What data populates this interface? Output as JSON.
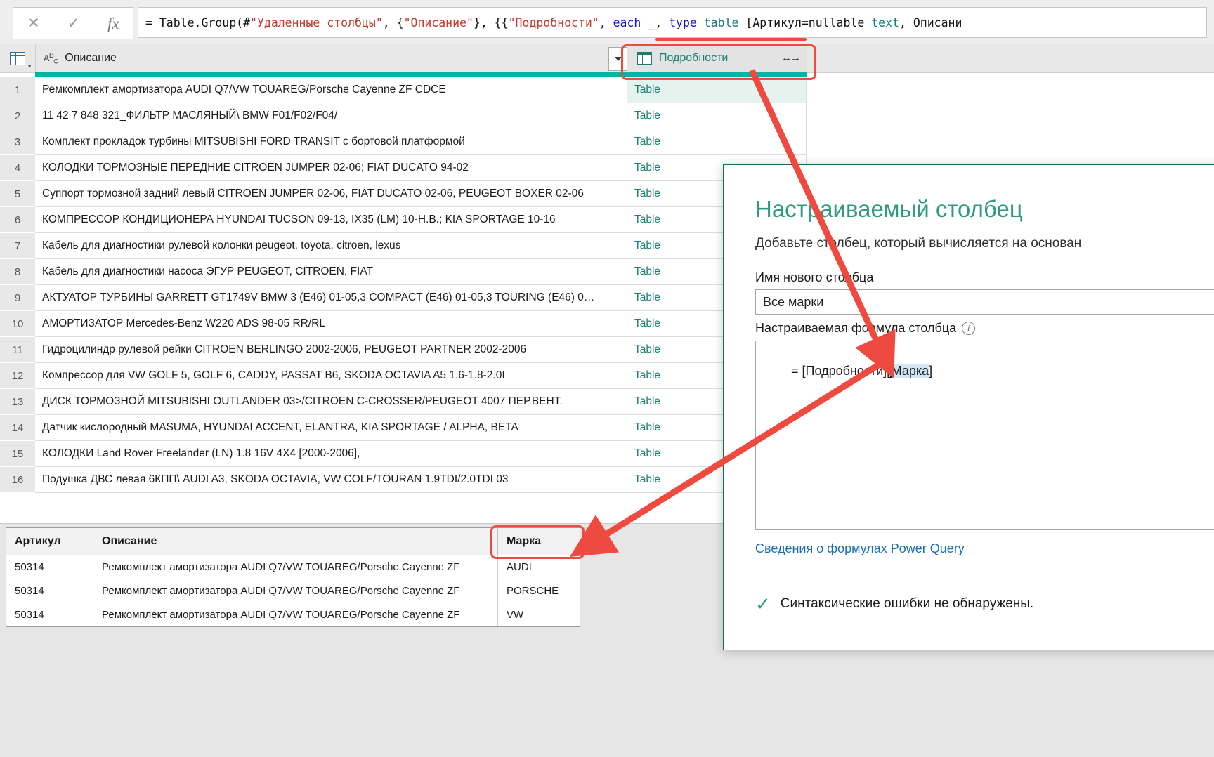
{
  "formula_bar": {
    "cancel_icon": "close-icon",
    "accept_icon": "check-icon",
    "fx_icon": "fx-icon",
    "segments": [
      {
        "t": "= Table.Group(#",
        "k": "plain"
      },
      {
        "t": "\"Удаленные столбцы\"",
        "k": "string"
      },
      {
        "t": ", {",
        "k": "plain"
      },
      {
        "t": "\"Описание\"",
        "k": "string"
      },
      {
        "t": "}, {{",
        "k": "plain"
      },
      {
        "t": "\"Подробности\"",
        "k": "string"
      },
      {
        "t": ", ",
        "k": "plain"
      },
      {
        "t": "each",
        "k": "keyword"
      },
      {
        "t": " _, ",
        "k": "plain"
      },
      {
        "t": "type",
        "k": "keyword"
      },
      {
        "t": " ",
        "k": "plain"
      },
      {
        "t": "table",
        "k": "type"
      },
      {
        "t": " [Артикул=nullable ",
        "k": "plain"
      },
      {
        "t": "text",
        "k": "type"
      },
      {
        "t": ", Описани",
        "k": "plain"
      }
    ],
    "full_text": "= Table.Group(#\"Удаленные столбцы\", {\"Описание\"}, {{\"Подробности\", each _, type table [Артикул=nullable text, Описани"
  },
  "grid": {
    "columns": [
      {
        "label": "Описание",
        "type_icon": "abc-icon",
        "filter_icon": "filter-caret-icon"
      },
      {
        "label": "Подробности",
        "type_icon": "table-icon",
        "expand_icon": "expand-columns-icon"
      }
    ],
    "corner_icon": "select-all-grid-icon",
    "rows": [
      {
        "n": "1",
        "desc": "Ремкомплект амортизатора AUDI Q7/VW TOUAREG/Porsche Cayenne ZF CDCE",
        "detail": "Table"
      },
      {
        "n": "2",
        "desc": " 11 42 7 848 321_ФИЛЬТР МАСЛЯНЫЙ\\ BMW F01/F02/F04/",
        "detail": "Table"
      },
      {
        "n": "3",
        "desc": "Комплект прокладок турбины MITSUBISHI  FORD TRANSIT с бортовой платформой",
        "detail": "Table"
      },
      {
        "n": "4",
        "desc": "КОЛОДКИ ТОРМОЗНЫЕ ПЕРЕДНИЕ CITROEN JUMPER 02-06; FIAT DUCATO 94-02",
        "detail": "Table"
      },
      {
        "n": "5",
        "desc": "Суппорт тормозной задний левый CITROEN JUMPER 02-06, FIAT DUCATO 02-06, PEUGEOT BOXER 02-06",
        "detail": "Table"
      },
      {
        "n": "6",
        "desc": "КОМПРЕССОР КОНДИЦИОНЕРА HYUNDAI TUCSON 09-13, IX35 (LM) 10-H.B.; KIA SPORTAGE 10-16",
        "detail": "Table"
      },
      {
        "n": "7",
        "desc": "Кабель для диагностики рулевой колонки peugeot, toyota, citroen, lexus",
        "detail": "Table"
      },
      {
        "n": "8",
        "desc": "Кабель для диагностики насоса ЭГУР PEUGEOT, CITROEN, FIAT",
        "detail": "Table"
      },
      {
        "n": "9",
        "desc": "АКТУАТОР ТУРБИНЫ GARRETT GT1749V BMW 3 (E46) 01-05,3 COMPACT (E46) 01-05,3 TOURING (E46) 0…",
        "detail": "Table"
      },
      {
        "n": "10",
        "desc": "АМОРТИЗАТОР Mercedes-Benz W220 ADS 98-05 RR/RL",
        "detail": "Table"
      },
      {
        "n": "11",
        "desc": "Гидроцилиндр рулевой рейки CITROEN BERLINGO 2002-2006, PEUGEOT PARTNER 2002-2006",
        "detail": "Table"
      },
      {
        "n": "12",
        "desc": "Компрессор для VW GOLF 5, GOLF 6, CADDY, PASSAT B6, SKODA OCTAVIA A5 1.6-1.8-2.0I",
        "detail": "Table"
      },
      {
        "n": "13",
        "desc": "ДИСК ТОРМОЗНОЙ MITSUBISHI OUTLANDER 03>/CITROEN C-CROSSER/PEUGEOT 4007 ПЕР.ВЕНТ.",
        "detail": "Table"
      },
      {
        "n": "14",
        "desc": "Датчик кислородный MASUMA, HYUNDAI ACCENT, ELANTRA, KIA SPORTAGE / ALPHA, BETA",
        "detail": "Table"
      },
      {
        "n": "15",
        "desc": "КОЛОДКИ Land Rover Freelander (LN) 1.8 16V 4X4 [2000-2006],",
        "detail": "Table"
      },
      {
        "n": "16",
        "desc": "Подушка ДВС левая 6КПП\\ AUDI A3, SKODA OCTAVIA, VW COLF/TOURAN 1.9TDI/2.0TDI 03",
        "detail": "Table"
      }
    ]
  },
  "preview": {
    "headers": [
      "Артикул",
      "Описание",
      "Марка"
    ],
    "rows": [
      [
        "50314",
        "Ремкомплект амортизатора AUDI Q7/VW TOUAREG/Porsche Cayenne ZF",
        "AUDI"
      ],
      [
        "50314",
        "Ремкомплект амортизатора AUDI Q7/VW TOUAREG/Porsche Cayenne ZF",
        "PORSCHE"
      ],
      [
        "50314",
        "Ремкомплект амортизатора AUDI Q7/VW TOUAREG/Porsche Cayenne ZF",
        "VW"
      ]
    ]
  },
  "dialog": {
    "title": "Настраиваемый столбец",
    "subtitle": "Добавьте столбец, который вычисляется на основан",
    "name_label": "Имя нового столбца",
    "name_value": "Все марки",
    "formula_label": "Настраиваемая формула столбца",
    "info_icon": "info-icon",
    "formula_prefix": "= [Подробности][",
    "formula_selected": "Марка",
    "formula_suffix": "]",
    "formula_value": "= [Подробности][Марка]",
    "help_link": "Сведения о формулах Power Query",
    "status_icon": "check-icon",
    "status_text": "Синтаксические ошибки не обнаружены."
  },
  "annotations": {
    "accent_color": "#ef4a40",
    "highlight_detail_column": "Подробности",
    "highlight_marka_column": "Марка"
  }
}
